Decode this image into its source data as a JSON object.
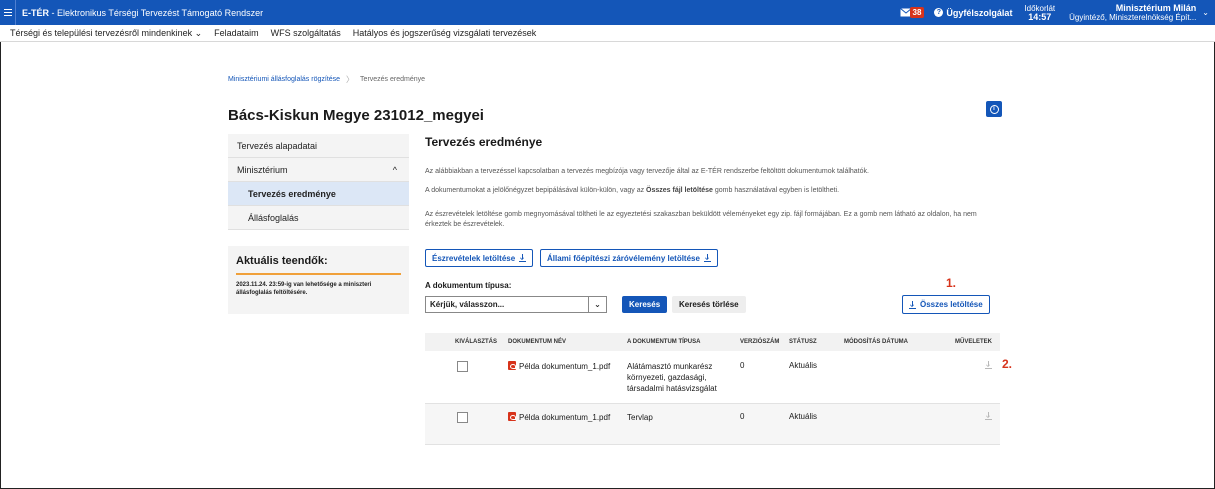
{
  "app": {
    "name": "E-TÉR",
    "subtitle": " - Elektronikus Térségi Tervezést Támogató Rendszer"
  },
  "topbar": {
    "mail_count": "38",
    "support_label": "Ügyfélszolgálat",
    "timelimit_label": "Időkorlát",
    "timelimit_value": "14:57",
    "user_name": "Minisztérium Milán",
    "user_role": "Ügyintéző, Miniszterelnökség Épít..."
  },
  "nav": {
    "items": [
      "Térségi és települési tervezésről mindenkinek ⌄",
      "Feladataim",
      "WFS szolgáltatás",
      "Hatályos és jogszerűség vizsgálati tervezések"
    ]
  },
  "breadcrumb": {
    "parent": "Minisztériumi állásfoglalás rögzítése",
    "current": "Tervezés eredménye"
  },
  "page": {
    "title": "Bács-Kiskun Megye 231012_megyei"
  },
  "sidebar": {
    "items": [
      {
        "label": "Tervezés alapadatai"
      },
      {
        "label": "Minisztérium",
        "chevron": "^"
      },
      {
        "label": "Tervezés eredménye"
      },
      {
        "label": "Állásfoglalás"
      }
    ]
  },
  "todo": {
    "title": "Aktuális teendők:",
    "text": "2023.11.24. 23:59-ig van lehetősége a miniszteri állásfoglalás feltöltésére."
  },
  "main": {
    "title": "Tervezés eredménye",
    "para1": "Az alábbiakban a tervezéssel kapcsolatban a tervezés megbízója vagy tervezője által az E-TÉR rendszerbe feltöltött dokumentumok találhatók.",
    "para2a": "A dokumentumokat a jelölőnégyzet bepipálásával külön-külön, vagy az ",
    "para2b": "Összes fájl letöltése",
    "para2c": " gomb használatával egyben is letöltheti.",
    "para3": "Az észrevételek letöltése gomb megnyomásával töltheti le az egyeztetési szakaszban beküldött véleményeket egy zip. fájl formájában. Ez a gomb nem látható az oldalon, ha nem érkeztek be észrevételek.",
    "btn_remarks": "Észrevételek letöltése",
    "btn_state": "Állami főépítészi záróvélemény letöltése",
    "doc_type_label": "A dokumentum típusa:",
    "select_placeholder": "Kérjük, válasszon...",
    "btn_search": "Keresés",
    "btn_clear": "Keresés törlése",
    "btn_all": "Összes letöltése",
    "marker1": "1.",
    "marker2": "2."
  },
  "table": {
    "headers": [
      "KIVÁLASZTÁS",
      "DOKUMENTUM NÉV",
      "A DOKUMENTUM TÍPUSA",
      "VERZIÓSZÁM",
      "STÁTUSZ",
      "MÓDOSÍTÁS DÁTUMA",
      "MŰVELETEK"
    ],
    "rows": [
      {
        "name": "Példa dokumentum_1.pdf",
        "type": "Alátámasztó munkarész környezeti, gazdasági, társadalmi hatásvizsgálat",
        "version": "0",
        "status": "Aktuális",
        "modified": ""
      },
      {
        "name": "Példa dokumentum_1.pdf",
        "type": "Tervlap",
        "version": "0",
        "status": "Aktuális",
        "modified": ""
      }
    ]
  },
  "colors": {
    "primary": "#1456b8",
    "badge": "#d7331b",
    "todo_accent": "#f0a03a"
  }
}
